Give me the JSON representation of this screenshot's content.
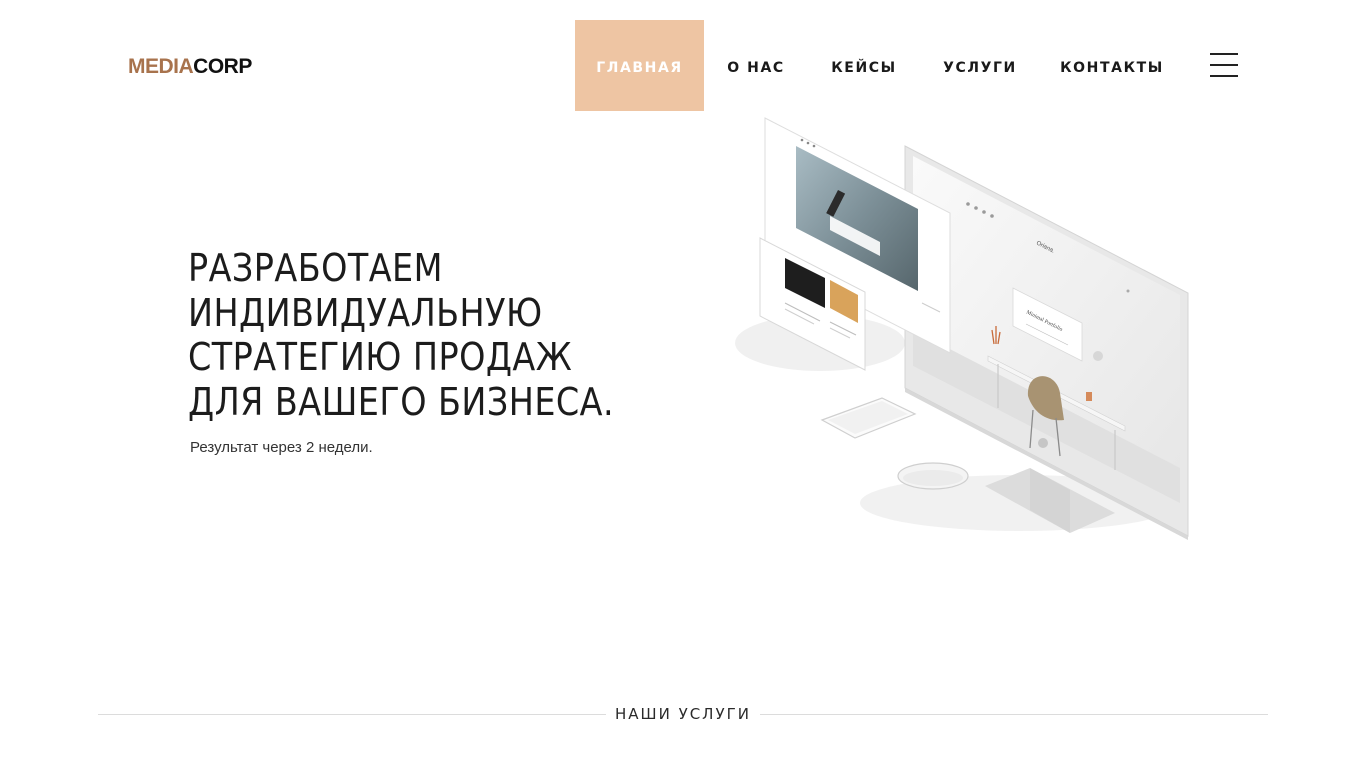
{
  "brand": {
    "logo_part1": "MEDIA",
    "logo_part2": "CORP",
    "accent": "#eec5a3",
    "logo_color": "#a8734d"
  },
  "nav": {
    "items": [
      {
        "label": "ГЛАВНАЯ",
        "active": true
      },
      {
        "label": "О НАС",
        "active": false
      },
      {
        "label": "КЕЙСЫ",
        "active": false
      },
      {
        "label": "УСЛУГИ",
        "active": false
      },
      {
        "label": "КОНТАКТЫ",
        "active": false
      }
    ],
    "menu_icon": "hamburger-icon"
  },
  "hero": {
    "title_lines": [
      "РАЗРАБОТАЕМ",
      "ИНДИВИДУАЛЬНУЮ",
      "СТРАТЕГИЮ ПРОДАЖ",
      "ДЛЯ ВАШЕГО БИЗНЕСА."
    ],
    "subtitle": "Результат через 2 недели.",
    "mockup_brand": "Oriana.",
    "mockup_card_title": "Minimal Portfolio"
  },
  "services_section": {
    "title": "НАШИ УСЛУГИ"
  }
}
